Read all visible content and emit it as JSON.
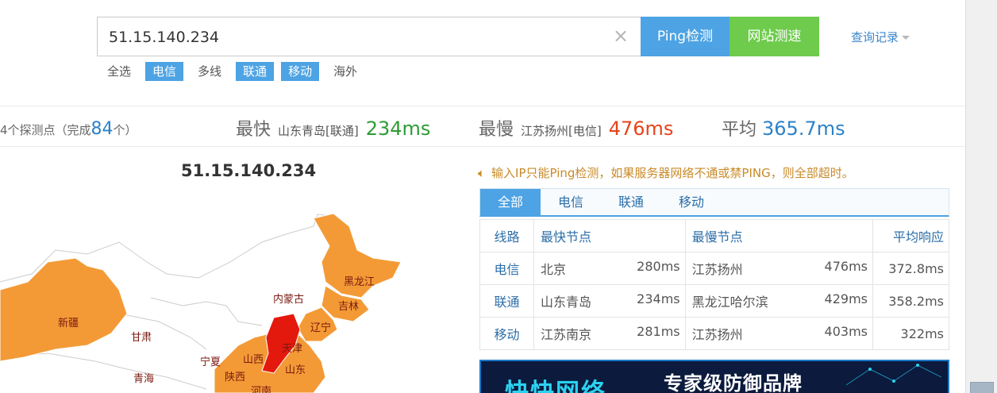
{
  "search": {
    "value": "51.15.140.234",
    "ping_label": "Ping检测",
    "speed_label": "网站测速",
    "history_label": "查询记录"
  },
  "filters": [
    {
      "label": "全选",
      "active": false
    },
    {
      "label": "电信",
      "active": true
    },
    {
      "label": "多线",
      "active": false
    },
    {
      "label": "联通",
      "active": true
    },
    {
      "label": "移动",
      "active": true
    },
    {
      "label": "海外",
      "active": false
    }
  ],
  "stats": {
    "count_prefix": "4个探测点（完成",
    "count_done": "84",
    "count_suffix": "个）",
    "fastest_label": "最快",
    "fastest_loc": "山东青岛[联通]",
    "fastest_val": "234ms",
    "slowest_label": "最慢",
    "slowest_loc": "江苏扬州[电信]",
    "slowest_val": "476ms",
    "avg_label": "平均",
    "avg_val": "365.7ms"
  },
  "map": {
    "title": "51.15.140.234",
    "provinces": [
      "新疆",
      "甘肃",
      "青海",
      "内蒙古",
      "黑龙江",
      "吉林",
      "辽宁",
      "宁夏",
      "陕西",
      "山西",
      "天津",
      "山东",
      "河南"
    ],
    "colors": {
      "normal": "#f39a36",
      "slow": "#e4190d",
      "border": "#ffffff",
      "outline": "#cccccc"
    }
  },
  "notice": "输入IP只能Ping检测，如果服务器网络不通或禁PING，则全部超时。",
  "tabs": [
    {
      "label": "全部",
      "active": true
    },
    {
      "label": "电信",
      "active": false
    },
    {
      "label": "联通",
      "active": false
    },
    {
      "label": "移动",
      "active": false
    }
  ],
  "table": {
    "headers": {
      "line": "线路",
      "fastest": "最快节点",
      "slowest": "最慢节点",
      "avg": "平均响应"
    },
    "rows": [
      {
        "line": "电信",
        "fast_node": "北京",
        "fast_ms": "280ms",
        "slow_node": "江苏扬州",
        "slow_ms": "476ms",
        "avg": "372.8ms"
      },
      {
        "line": "联通",
        "fast_node": "山东青岛",
        "fast_ms": "234ms",
        "slow_node": "黑龙江哈尔滨",
        "slow_ms": "429ms",
        "avg": "358.2ms"
      },
      {
        "line": "移动",
        "fast_node": "江苏南京",
        "fast_ms": "281ms",
        "slow_node": "江苏扬州",
        "slow_ms": "403ms",
        "avg": "322ms"
      }
    ]
  },
  "banner": {
    "text_left": "快快网络",
    "text_right": "专家级防御品牌"
  }
}
